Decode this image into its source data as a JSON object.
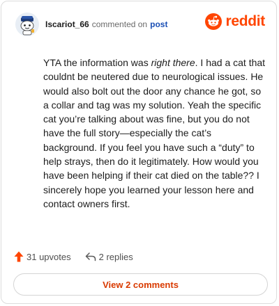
{
  "comment": {
    "author": "Iscariot_66",
    "action_text": "commented on",
    "target_link": "post",
    "body_part1": "YTA the information was ",
    "body_emphasis": "right there",
    "body_part2": ". I had a cat that couldnt be neutered due to neurological issues. He would also bolt out the door any chance he got, so a collar and tag was my solution. Yeah the specific cat you’re talking about was fine, but you do not have the full story—especially the cat’s background. If you feel you have such a “duty” to help strays, then do it legitimately. How would you have been helping if their cat died on the table?? I sincerely hope you learned your lesson here and contact owners first."
  },
  "brand": {
    "name": "reddit",
    "icon": "reddit-logo-icon"
  },
  "stats": {
    "upvotes": "31 upvotes",
    "replies": "2 replies"
  },
  "footer": {
    "view_comments_label": "View 2 comments"
  },
  "colors": {
    "brand": "#ff4500",
    "upvote": "#ff4500",
    "link": "#1a4fb5",
    "button_text": "#d93a00",
    "border": "#dcdcdc"
  }
}
